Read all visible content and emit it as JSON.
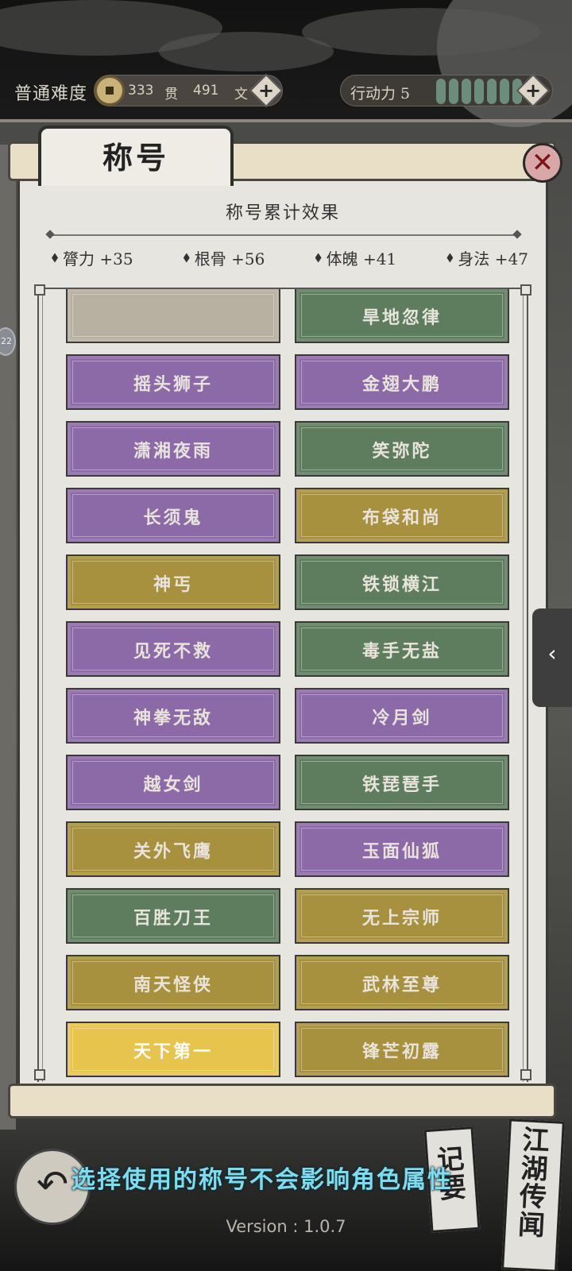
{
  "header": {
    "difficulty": "普通难度",
    "money_guan_value": "333",
    "money_guan_unit": "贯",
    "money_wen_value": "491",
    "money_wen_unit": "文",
    "stamina_label": "行动力 5",
    "stamina_level": 5,
    "add_symbol": "+"
  },
  "panel": {
    "title": "称号",
    "close_symbol": "✕",
    "effect_title": "称号累计效果",
    "stats": [
      {
        "label": "膂力 +35"
      },
      {
        "label": "根骨 +56"
      },
      {
        "label": "体魄 +41"
      },
      {
        "label": "身法 +47"
      }
    ]
  },
  "titles": [
    {
      "name": "",
      "color": "grey"
    },
    {
      "name": "旱地忽律",
      "color": "green"
    },
    {
      "name": "摇头狮子",
      "color": "purple"
    },
    {
      "name": "金翅大鹏",
      "color": "purple"
    },
    {
      "name": "潇湘夜雨",
      "color": "purple"
    },
    {
      "name": "笑弥陀",
      "color": "green"
    },
    {
      "name": "长须鬼",
      "color": "purple"
    },
    {
      "name": "布袋和尚",
      "color": "gold"
    },
    {
      "name": "神丐",
      "color": "gold"
    },
    {
      "name": "铁锁横江",
      "color": "green"
    },
    {
      "name": "见死不救",
      "color": "purple"
    },
    {
      "name": "毒手无盐",
      "color": "green"
    },
    {
      "name": "神拳无敌",
      "color": "purple"
    },
    {
      "name": "冷月剑",
      "color": "purple"
    },
    {
      "name": "越女剑",
      "color": "purple"
    },
    {
      "name": "铁琵琶手",
      "color": "green"
    },
    {
      "name": "关外飞鹰",
      "color": "gold"
    },
    {
      "name": "玉面仙狐",
      "color": "purple"
    },
    {
      "name": "百胜刀王",
      "color": "green"
    },
    {
      "name": "无上宗师",
      "color": "gold"
    },
    {
      "name": "南天怪侠",
      "color": "gold"
    },
    {
      "name": "武林至尊",
      "color": "gold"
    },
    {
      "name": "天下第一",
      "color": "bright"
    },
    {
      "name": "锋芒初露",
      "color": "gold"
    }
  ],
  "colors": {
    "purple": "#8c6aa8",
    "green": "#5e7d5e",
    "gold": "#a8913e",
    "bright": "#e7c44e",
    "hint": "#7fdcef"
  },
  "side_tab_symbol": "‹",
  "footer": {
    "back_symbol": "↶",
    "hint": "选择使用的称号不会影响角色属性",
    "book1": "记要",
    "book2": "江湖传闻",
    "version": "Version : 1.0.7"
  }
}
